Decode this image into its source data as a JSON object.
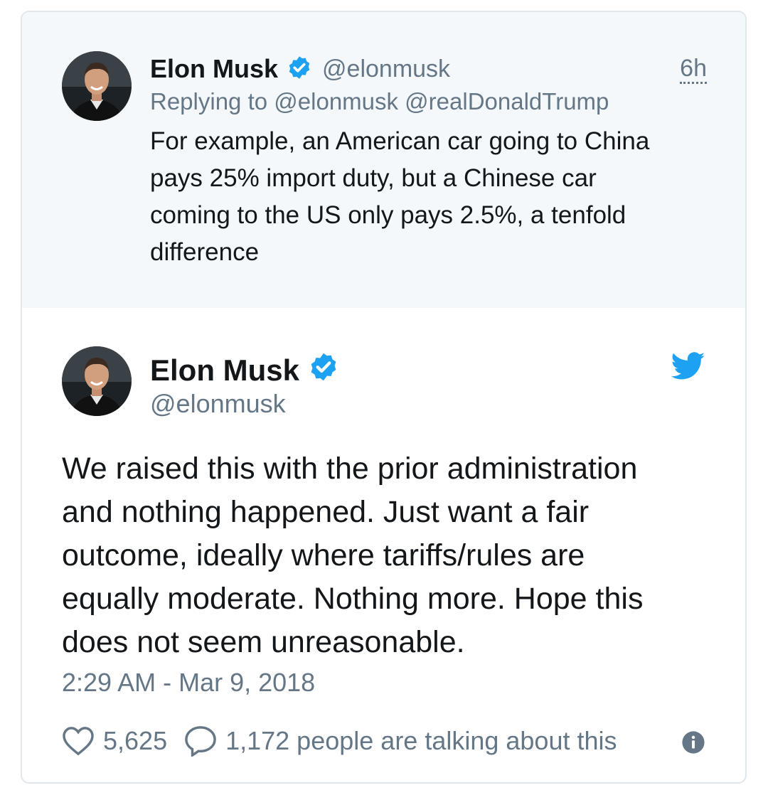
{
  "parent_tweet": {
    "name": "Elon Musk",
    "handle": "@elonmusk",
    "time": "6h",
    "replying_prefix": "Replying to",
    "replying_to": "@elonmusk @realDonaldTrump",
    "text_lines": [
      "For example, an American car going to China",
      "pays 25% import duty, but a  Chinese car",
      "coming to the US only pays 2.5%, a tenfold",
      "difference"
    ]
  },
  "main_tweet": {
    "name": "Elon Musk",
    "handle": "@elonmusk",
    "text_lines": [
      "We raised this with the prior administration",
      "and nothing happened. Just want a fair",
      "outcome, ideally where tariffs/rules are",
      "equally moderate. Nothing more. Hope this",
      "does not seem unreasonable."
    ],
    "timestamp": "2:29 AM - Mar 9, 2018",
    "likes": "5,625",
    "talking": "1,172 people are talking about this"
  },
  "icons": {
    "verified": "verified-badge-icon",
    "bird": "twitter-bird-icon",
    "heart": "heart-icon",
    "reply": "reply-bubble-icon",
    "info": "info-icon"
  },
  "colors": {
    "brand_blue": "#1da1f2",
    "muted_text": "#657786",
    "parent_bg": "#f5f8fa"
  }
}
